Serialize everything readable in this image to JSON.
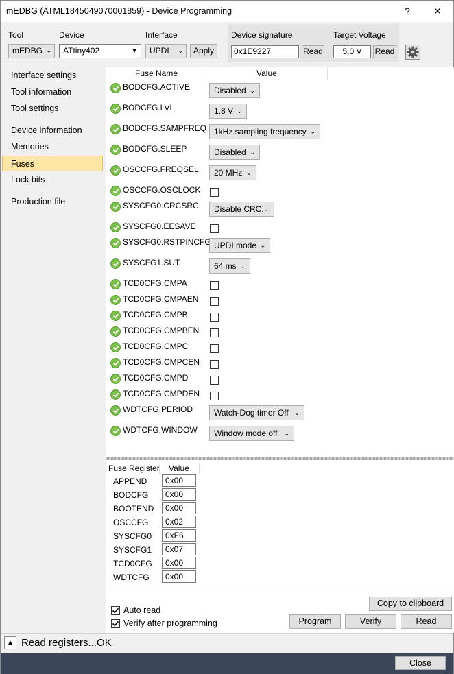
{
  "window": {
    "title": "mEDBG (ATML1845049070001859) - Device Programming",
    "help": "?",
    "close": "✕"
  },
  "toolbar": {
    "tool_label": "Tool",
    "tool_value": "mEDBG",
    "device_label": "Device",
    "device_value": "ATtiny402",
    "interface_label": "Interface",
    "interface_value": "UPDI",
    "apply_label": "Apply",
    "signature_label": "Device signature",
    "signature_value": "0x1E9227",
    "signature_read": "Read",
    "voltage_label": "Target Voltage",
    "voltage_value": "5,0 V",
    "voltage_read": "Read",
    "settings_icon": "gear-icon"
  },
  "sidebar": {
    "items": [
      {
        "label": "Interface settings"
      },
      {
        "label": "Tool information"
      },
      {
        "label": "Tool settings"
      },
      {
        "label": "Device information"
      },
      {
        "label": "Memories"
      },
      {
        "label": "Fuses"
      },
      {
        "label": "Lock bits"
      },
      {
        "label": "Production file"
      }
    ],
    "selected": "Fuses"
  },
  "fuses": {
    "col_name": "Fuse Name",
    "col_value": "Value",
    "rows": [
      {
        "name": "BODCFG.ACTIVE",
        "value": "Disabled"
      },
      {
        "name": "BODCFG.LVL",
        "value": "1.8 V"
      },
      {
        "name": "BODCFG.SAMPFREQ",
        "value": "1kHz sampling frequency"
      },
      {
        "name": "BODCFG.SLEEP",
        "value": "Disabled"
      },
      {
        "name": "OSCCFG.FREQSEL",
        "value": "20 MHz"
      },
      {
        "name": "OSCCFG.OSCLOCK",
        "checked": false
      },
      {
        "name": "SYSCFG0.CRCSRC",
        "value": "Disable CRC."
      },
      {
        "name": "SYSCFG0.EESAVE",
        "checked": false
      },
      {
        "name": "SYSCFG0.RSTPINCFG",
        "value": "UPDI mode"
      },
      {
        "name": "SYSCFG1.SUT",
        "value": "64 ms"
      },
      {
        "name": "TCD0CFG.CMPA",
        "checked": false
      },
      {
        "name": "TCD0CFG.CMPAEN",
        "checked": false
      },
      {
        "name": "TCD0CFG.CMPB",
        "checked": false
      },
      {
        "name": "TCD0CFG.CMPBEN",
        "checked": false
      },
      {
        "name": "TCD0CFG.CMPC",
        "checked": false
      },
      {
        "name": "TCD0CFG.CMPCEN",
        "checked": false
      },
      {
        "name": "TCD0CFG.CMPD",
        "checked": false
      },
      {
        "name": "TCD0CFG.CMPDEN",
        "checked": false
      },
      {
        "name": "WDTCFG.PERIOD",
        "value": "Watch-Dog timer Off"
      },
      {
        "name": "WDTCFG.WINDOW",
        "value": "Window mode off"
      }
    ]
  },
  "registers": {
    "col_name": "Fuse Register",
    "col_value": "Value",
    "rows": [
      {
        "name": "APPEND",
        "value": "0x00"
      },
      {
        "name": "BODCFG",
        "value": "0x00"
      },
      {
        "name": "BOOTEND",
        "value": "0x00"
      },
      {
        "name": "OSCCFG",
        "value": "0x02"
      },
      {
        "name": "SYSCFG0",
        "value": "0xF6"
      },
      {
        "name": "SYSCFG1",
        "value": "0x07"
      },
      {
        "name": "TCD0CFG",
        "value": "0x00"
      },
      {
        "name": "WDTCFG",
        "value": "0x00"
      }
    ]
  },
  "actions": {
    "auto_read": "Auto read",
    "auto_read_checked": true,
    "verify_after": "Verify after programming",
    "verify_after_checked": true,
    "copy_clipboard": "Copy to clipboard",
    "program": "Program",
    "verify": "Verify",
    "read": "Read"
  },
  "status": {
    "text": "Read registers...OK",
    "toggle": "▲"
  },
  "footer": {
    "close": "Close"
  }
}
